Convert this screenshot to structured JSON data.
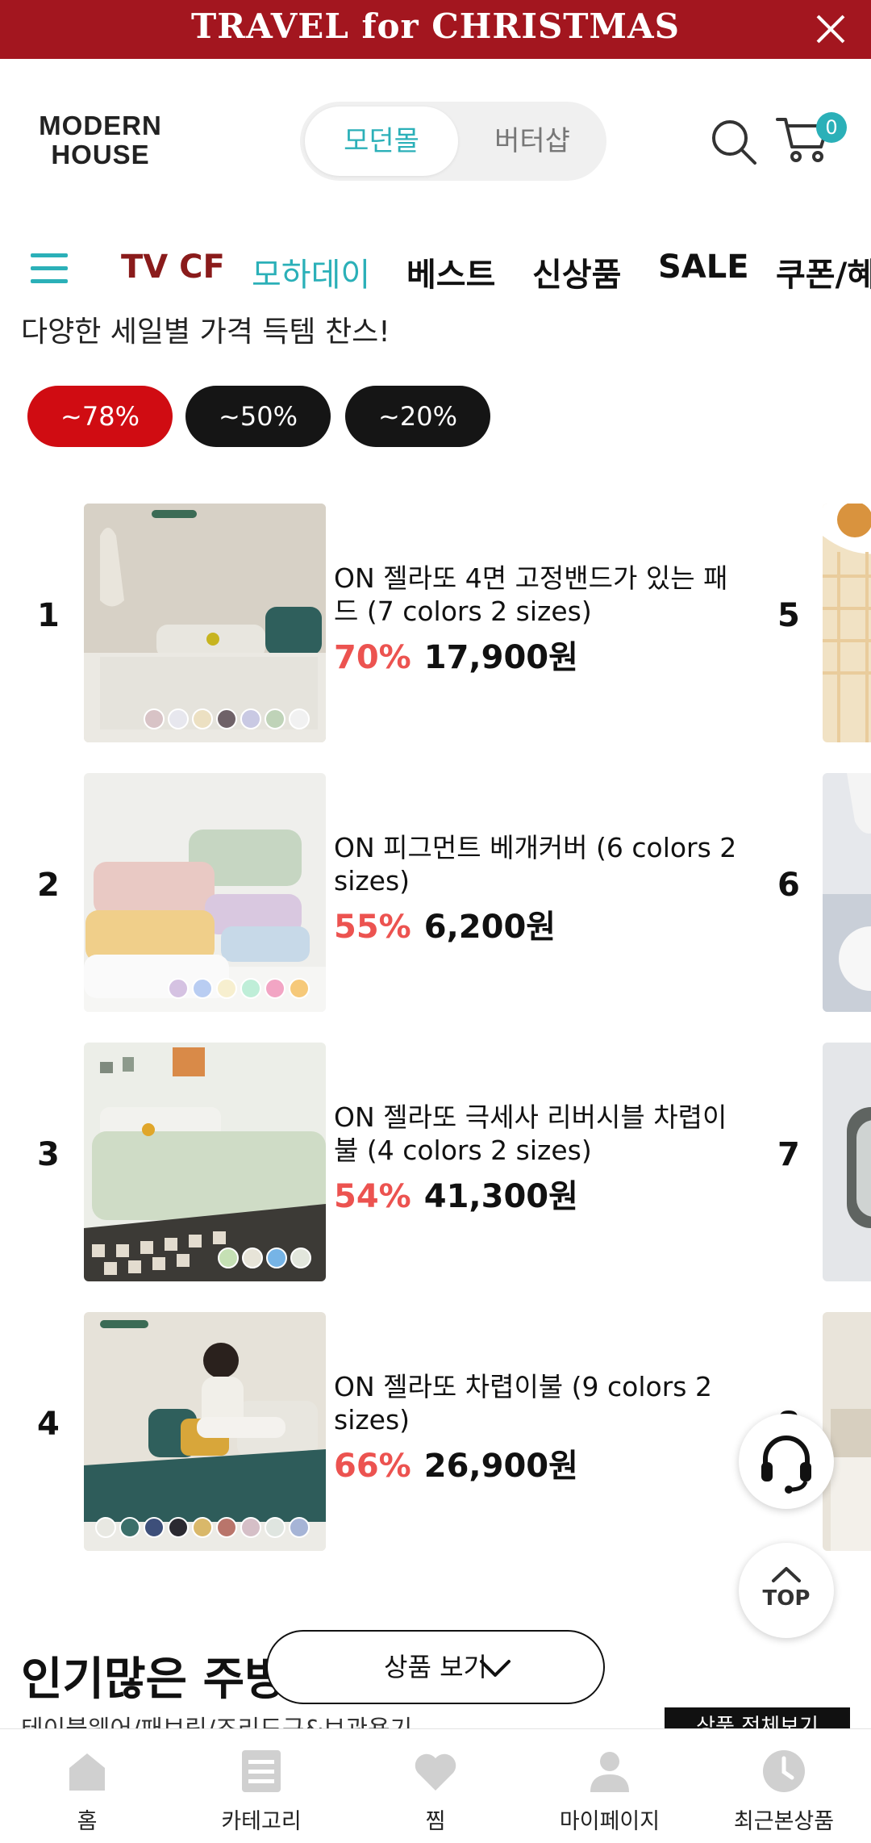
{
  "promo": {
    "text": "TRAVEL for CHRISTMAS",
    "color": "#a3161f"
  },
  "header": {
    "logo_line1": "MODERN",
    "logo_line2": "HOUSE",
    "mall_active": "모던몰",
    "mall_inactive": "버터샵",
    "cart_count": "0",
    "accent": "#2bb0b8"
  },
  "nav": {
    "items": [
      "TV CF",
      "모하데이",
      "베스트",
      "신상품",
      "SALE",
      "쿠폰/혜"
    ]
  },
  "sale": {
    "subtitle": "다양한 세일별 가격 득템 찬스!",
    "chips": [
      "~78%",
      "~50%",
      "~20%"
    ]
  },
  "products": [
    {
      "rank": "1",
      "name": "ON 젤라또 4면 고정밴드가 있는 패드 (7 colors 2 sizes)",
      "discount": "70%",
      "price": "17,900원"
    },
    {
      "rank": "2",
      "name": "ON 피그먼트 베개커버 (6 colors 2 sizes)",
      "discount": "55%",
      "price": "6,200원"
    },
    {
      "rank": "3",
      "name": "ON 젤라또 극세사 리버시블 차렵이불 (4 colors 2 sizes)",
      "discount": "54%",
      "price": "41,300원"
    },
    {
      "rank": "4",
      "name": "ON 젤라또 차렵이불 (9 colors 2 sizes)",
      "discount": "66%",
      "price": "26,900원"
    }
  ],
  "right_column_ranks": [
    "5",
    "6",
    "7",
    "8"
  ],
  "floating": {
    "top_label": "TOP"
  },
  "section": {
    "title": "인기많은 주방",
    "subtitle": "테이블웨어/패브릭/조리도구&보관용기",
    "view_all": "상품 전체보기",
    "view_products": "상품 보기"
  },
  "bottom_tabs": [
    "홈",
    "카테고리",
    "찜",
    "마이페이지",
    "최근본상품"
  ]
}
